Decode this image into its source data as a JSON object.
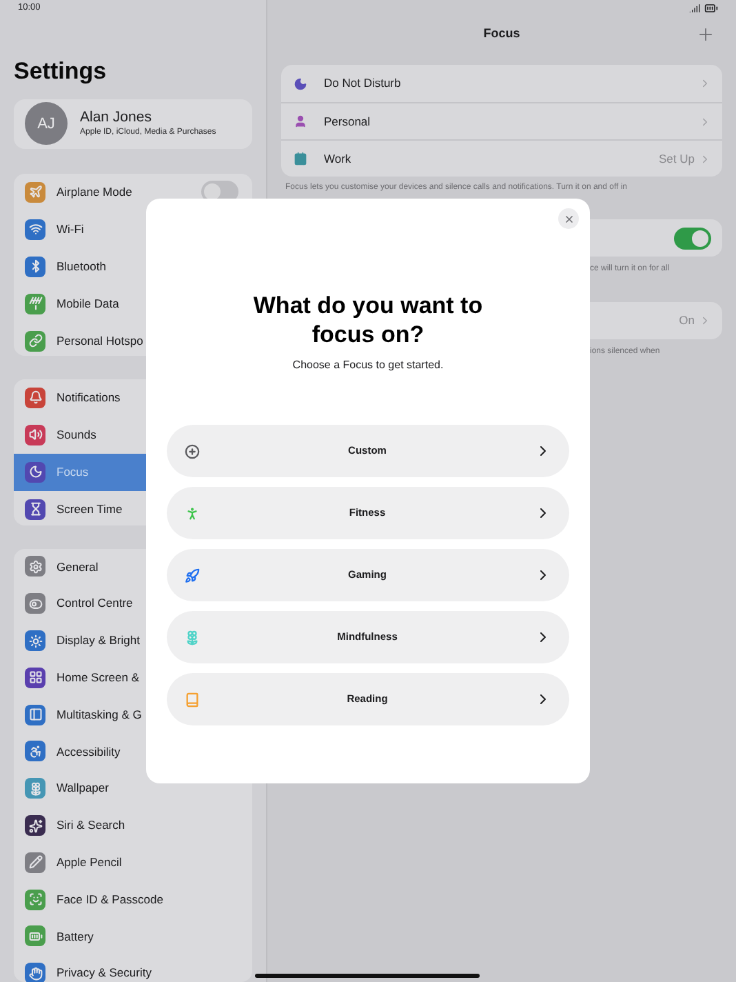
{
  "status_bar": {
    "time": "10:00"
  },
  "sidebar": {
    "title": "Settings",
    "account": {
      "initials": "AJ",
      "name": "Alan Jones",
      "subtitle": "Apple ID, iCloud, Media & Purchases"
    },
    "groups": [
      [
        {
          "label": "Airplane Mode",
          "kind": "toggle",
          "on": false,
          "selected": false,
          "color": "#c98a3c"
        },
        {
          "label": "Wi-Fi",
          "kind": "link",
          "selected": false,
          "color": "#2f6fc4"
        },
        {
          "label": "Bluetooth",
          "kind": "link",
          "selected": false,
          "color": "#2f6fc4"
        },
        {
          "label": "Mobile Data",
          "kind": "link",
          "selected": false,
          "color": "#4a9e4d"
        },
        {
          "label": "Personal Hotspo",
          "kind": "link",
          "selected": false,
          "color": "#4a9e4d"
        }
      ],
      [
        {
          "label": "Notifications",
          "kind": "link",
          "selected": false,
          "color": "#c8443a"
        },
        {
          "label": "Sounds",
          "kind": "link",
          "selected": false,
          "color": "#c83a58"
        },
        {
          "label": "Focus",
          "kind": "link",
          "selected": true,
          "color": "#5248b0"
        },
        {
          "label": "Screen Time",
          "kind": "link",
          "selected": false,
          "color": "#5248b0"
        }
      ],
      [
        {
          "label": "General",
          "kind": "link",
          "selected": false,
          "color": "#7e7e84"
        },
        {
          "label": "Control Centre",
          "kind": "link",
          "selected": false,
          "color": "#7e7e84"
        },
        {
          "label": "Display & Bright",
          "kind": "link",
          "selected": false,
          "color": "#2f6fc4"
        },
        {
          "label": "Home Screen &",
          "kind": "link",
          "selected": false,
          "color": "#5a3fae"
        },
        {
          "label": "Multitasking & G",
          "kind": "link",
          "selected": false,
          "color": "#2f6fc4"
        },
        {
          "label": "Accessibility",
          "kind": "link",
          "selected": false,
          "color": "#2f6fc4"
        },
        {
          "label": "Wallpaper",
          "kind": "link",
          "selected": false,
          "color": "#4596b4"
        },
        {
          "label": "Siri & Search",
          "kind": "link",
          "selected": false,
          "color": "#3a2c50"
        },
        {
          "label": "Apple Pencil",
          "kind": "link",
          "selected": false,
          "color": "#7e7e84"
        },
        {
          "label": "Face ID & Passcode",
          "kind": "link",
          "selected": false,
          "color": "#4a9e4d"
        },
        {
          "label": "Battery",
          "kind": "link",
          "selected": false,
          "color": "#4a9e4d"
        },
        {
          "label": "Privacy & Security",
          "kind": "link",
          "selected": false,
          "color": "#2f6fc4"
        }
      ]
    ]
  },
  "detail": {
    "title": "Focus",
    "modes": [
      {
        "label": "Do Not Disturb",
        "color": "#5a4fb8"
      },
      {
        "label": "Personal",
        "color": "#9a4fb0"
      },
      {
        "label": "Work",
        "value": "Set Up",
        "color": "#3a8f9a"
      }
    ],
    "footnote": "Focus lets you customise your devices and silence calls and notifications. Turn it on and off in",
    "share_toggle": {
      "on": true
    },
    "footnote_2": "ce will turn it on for all",
    "status_row": {
      "value": "On"
    },
    "footnote_3": "ions silenced when"
  },
  "modal": {
    "title": "What do you want to focus on?",
    "subtitle": "Choose a Focus to get started.",
    "options": [
      {
        "label": "Custom",
        "color": "#5a5a5e"
      },
      {
        "label": "Fitness",
        "color": "#3cc44a"
      },
      {
        "label": "Gaming",
        "color": "#1f6ff0"
      },
      {
        "label": "Mindfulness",
        "color": "#4fd3c8"
      },
      {
        "label": "Reading",
        "color": "#f5a030"
      }
    ]
  }
}
